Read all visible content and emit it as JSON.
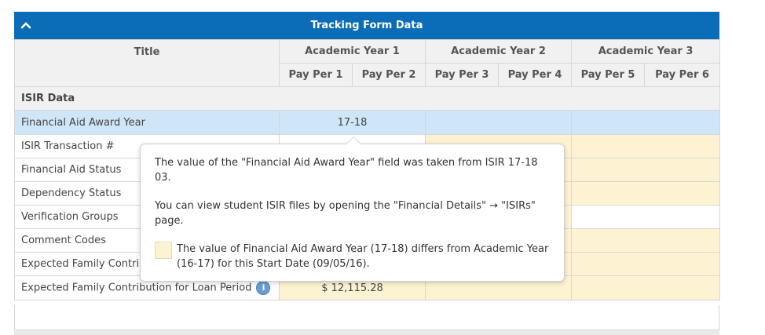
{
  "header": {
    "title": "Tracking Form Data",
    "collapse_icon": "chevron-up-icon",
    "color": "#0b6db8"
  },
  "columns": {
    "title": "Title",
    "groups": [
      "Academic Year 1",
      "Academic Year 2",
      "Academic Year 3"
    ],
    "periods": [
      "Pay Per 1",
      "Pay Per 2",
      "Pay Per 3",
      "Pay Per 4",
      "Pay Per 5",
      "Pay Per 6"
    ]
  },
  "section": "ISIR Data",
  "rows": [
    {
      "label": "Financial Aid Award Year",
      "ay1": "17-18"
    },
    {
      "label": "ISIR Transaction #"
    },
    {
      "label": "Financial Aid Status"
    },
    {
      "label": "Dependency Status"
    },
    {
      "label": "Verification Groups"
    },
    {
      "label": "Comment Codes"
    },
    {
      "label": "Expected Family Contri"
    },
    {
      "label": "Expected Family Contribution for Loan Period",
      "ay1": "$ 12,115.28",
      "info_icon": "i"
    }
  ],
  "tooltip": {
    "p1": "The value of the \"Financial Aid Award Year\" field was taken from ISIR 17-18 03.",
    "p2": "You can view student ISIR files by opening the \"Financial Details\" → \"ISIRs\" page.",
    "p3": "The value of Financial Aid Award Year (17-18) differs from Academic Year (16-17) for this Start Date (09/05/16).",
    "swatch_color": "#fdf3d3"
  }
}
